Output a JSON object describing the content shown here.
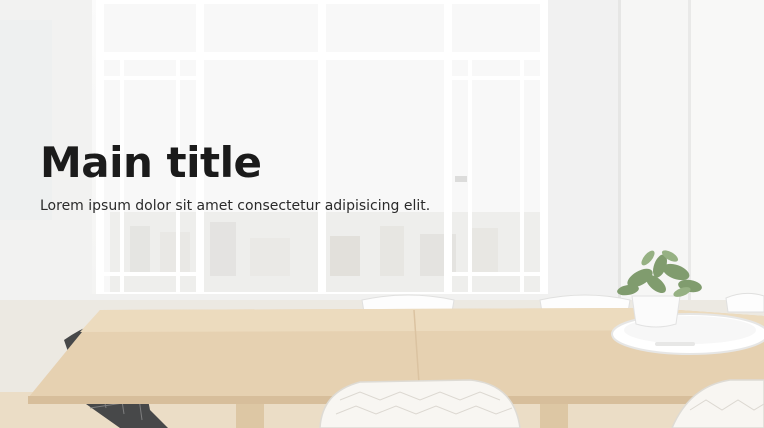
{
  "hero": {
    "title": "Main title",
    "subtitle": "Lorem ipsum dolor sit amet consectetur adipisicing elit."
  },
  "icons": {
    "background": "room-photo-icon"
  },
  "colors": {
    "title_text": "#1b1b1b",
    "subtitle_text": "#2a2a2a",
    "table_wood": "#e2c9a4"
  }
}
